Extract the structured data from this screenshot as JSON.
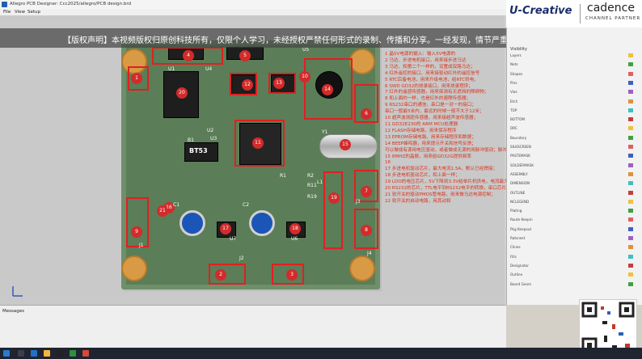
{
  "window": {
    "title": "Allegro PCB Designer: Ccc2025/allegro/PCB design.brd"
  },
  "menu": [
    "File",
    "View",
    "Setup"
  ],
  "watermark": "【版权声明】本视频版权归原创科技所有，仅限个人学习，未经授权严禁任何形式的录制、传播和分享。一经发现，情节严重者将承担法律责任。",
  "brand": {
    "left": "U-Creative",
    "right": "cadence",
    "sub": "CHANNEL PARTNER"
  },
  "visibility_title": "Visibility",
  "layers": [
    "Layers",
    "Nets",
    "Shapes",
    "Pins",
    "Vias",
    "Etch",
    "TOP",
    "BOTTOM",
    "DRC",
    "Boundary",
    "SILKSCREEN",
    "PASTEMASK",
    "SOLDERMASK",
    "ASSEMBLY",
    "DIMENSION",
    "OUTLINE",
    "NCLEGEND",
    "Plating",
    "Route Keepin",
    "Pkg Keepout",
    "Ratsnest",
    "Clines",
    "Fills",
    "Designator",
    "Outline",
    "Board Geom"
  ],
  "messages_label": "Messages",
  "silkscreen": [
    "U1",
    "U2",
    "U3",
    "U4",
    "U5",
    "U6",
    "U7",
    "R1",
    "R2",
    "C1",
    "C2",
    "J1",
    "J2",
    "J3",
    "J4",
    "Y1",
    "B1",
    "BT53",
    "R19",
    "R11",
    "L1"
  ],
  "markers": [
    "1",
    "2",
    "3",
    "4",
    "5",
    "6",
    "7",
    "8",
    "9",
    "10",
    "11",
    "12",
    "13",
    "14",
    "15",
    "16",
    "17",
    "18",
    "19",
    "20",
    "21"
  ],
  "notes": [
    "1  晶5V电源的输入：输入5V电源的",
    "2  马达、步进电机接口，用来接步进马达",
    "3  马达、和第二个一样的，设置成双路马达；",
    "4  红外遥控的接口，用来接驱动红外的遥控信号",
    "5  RTC后备电池，用来升级电池，给RTC供电，",
    "6  SWD GD32的烧录接口，用来烧录程序；",
    "7  红外的遥感传感器，用来探测有无遮挡的障碍物；",
    "8  和上面的一样，也是红外的避障传感器；",
    "9  RS232串口的通信，串口是一对一的接口；",
    "    串口一般最5米内，最远的时候一般不大于12米；",
    "10  超声波测距传感器，用来接超声波传感器；",
    "11  GD32E230的 ARM MCU处理器",
    "12  FLASH存储电路，用来保存程序",
    "13  EPROM存储电路，用来存储程序和数据；",
    "14  BEEP蜂鸣器，用来提示开关和信号反馈；",
    "    可以做成有源用电压驱动，或者做成无源的用脉冲驱动；脉冲范围4-15K范围；",
    "15  8MHZ的晶振，用来给GD32G提供频率",
    "16",
    "17  步进电机驱动芯片，最大电流1.5A，默认已经焊接；",
    "18  步进电机驱动芯片，和上面一样；",
    "19  LDO的电压芯片，5V下降到3.3V给单片机供电，电流最大700mA；",
    "20  RS232的芯片，TTL电平到RS232电平的转换，串口芯片",
    "21  软开关的驱动PMOS管电路，用来做马达电源控制；",
    "22  软开关的启动电路，用其动和"
  ],
  "colors": {
    "board": "#6f8f6a",
    "pad": "#d99a46",
    "marker": "#d32b2b",
    "note_text": "#d9341d",
    "cap": "#1b55b8"
  }
}
